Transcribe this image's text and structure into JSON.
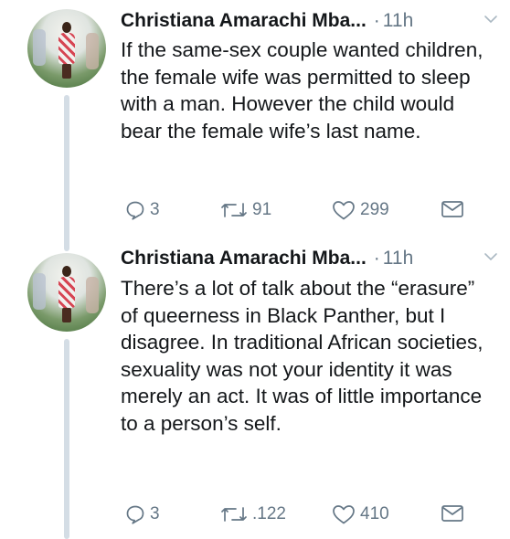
{
  "tweets": [
    {
      "author": "Christiana Amarachi Mba...",
      "separator": "·",
      "time": "11h",
      "text": "If the same-sex couple wanted children, the female wife was permitted to sleep with a man. However the child would bear the female wife’s last name.",
      "replies": "3",
      "retweets": "91",
      "likes": "299"
    },
    {
      "author": "Christiana Amarachi Mba...",
      "separator": "·",
      "time": "11h",
      "text": "There’s a lot of talk about the “erasure” of queerness in Black Panther, but I disagree. In traditional African societies, sexuality was not your identity it was merely an act. It was of little importance to a person’s self.",
      "replies": "3",
      "retweets": ".122",
      "likes": "410"
    }
  ],
  "icons": {
    "reply": "reply-icon",
    "retweet": "retweet-icon",
    "like": "heart-icon",
    "dm": "envelope-icon",
    "menu": "chevron-down-icon"
  },
  "colors": {
    "text": "#14171a",
    "muted": "#657786",
    "thread": "#d4dde5"
  }
}
